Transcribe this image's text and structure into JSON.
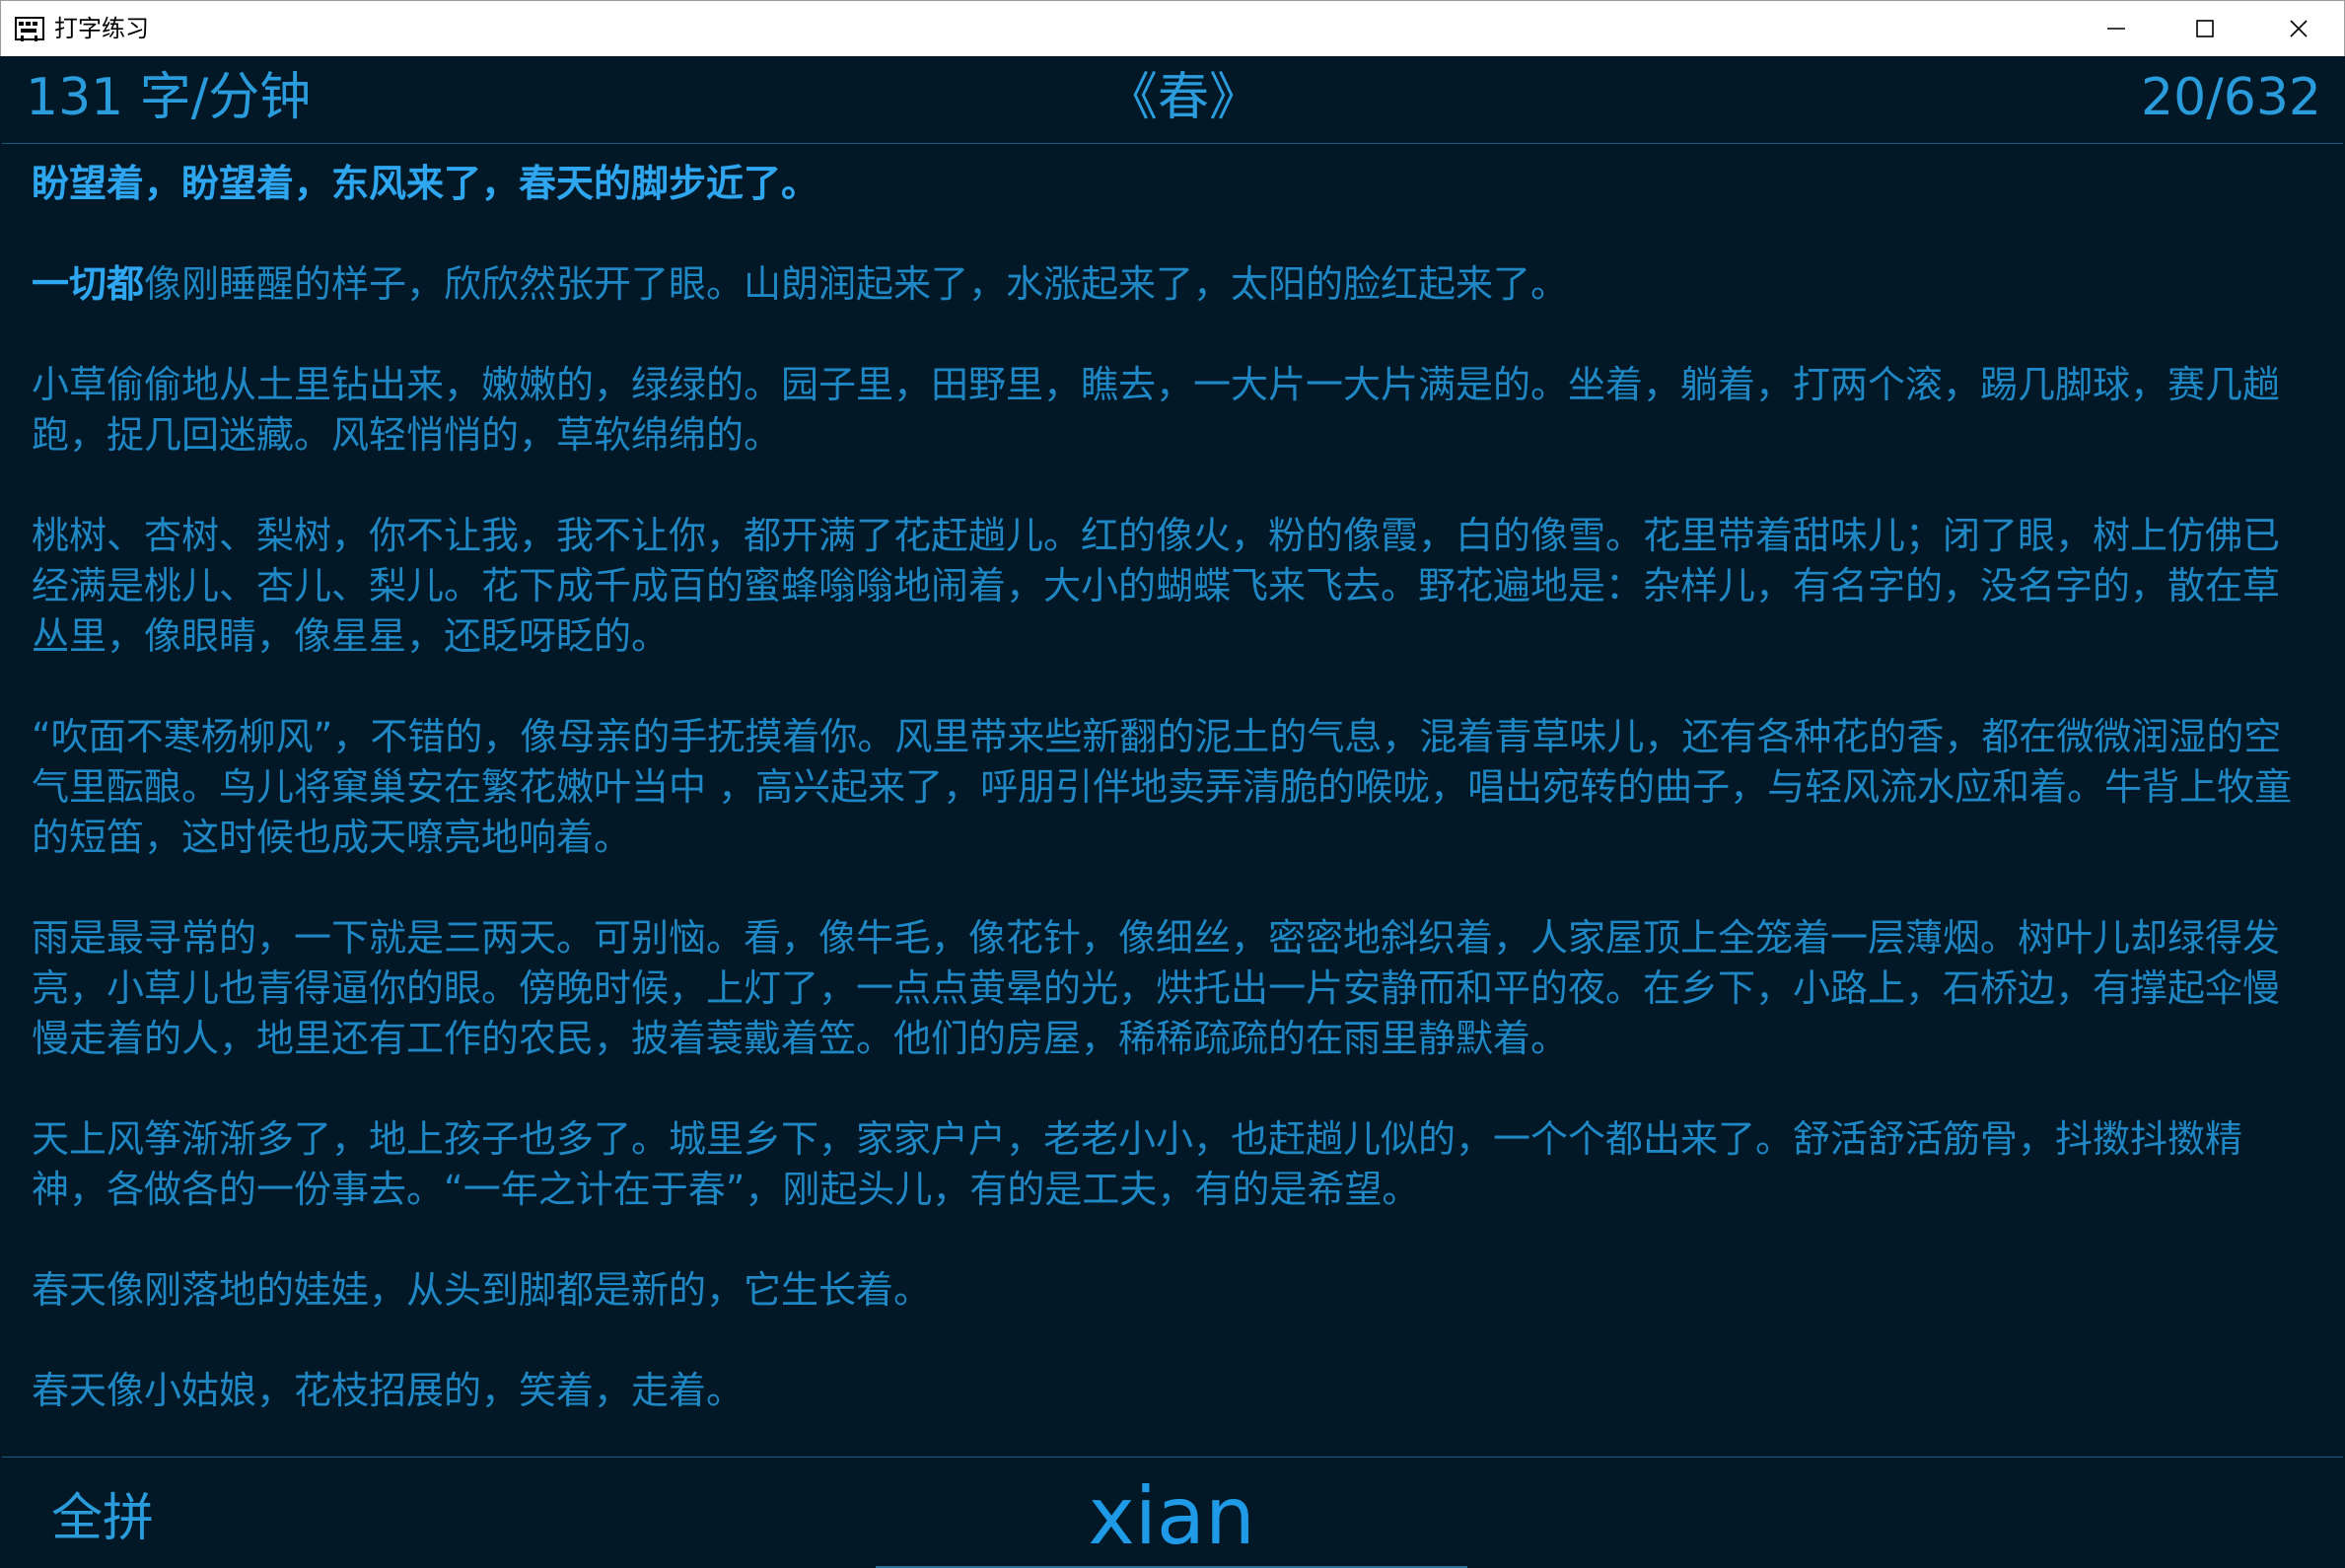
{
  "window": {
    "title": "打字练习"
  },
  "header": {
    "speed": "131 字/分钟",
    "article_title": "《春》",
    "progress": "20/632"
  },
  "content": {
    "paragraphs": [
      {
        "typed": "盼望着，盼望着，东风来了，春天的脚步近了。",
        "rest": ""
      },
      {
        "typed": "一切都",
        "rest": "像刚睡醒的样子，欣欣然张开了眼。山朗润起来了，水涨起来了，太阳的脸红起来了。"
      },
      {
        "typed": "",
        "rest": "小草偷偷地从土里钻出来，嫩嫩的，绿绿的。园子里，田野里，瞧去，一大片一大片满是的。坐着，躺着，打两个滚，踢几脚球，赛几趟跑，捉几回迷藏。风轻悄悄的，草软绵绵的。"
      },
      {
        "typed": "",
        "rest": "桃树、杏树、梨树，你不让我，我不让你，都开满了花赶趟儿。红的像火，粉的像霞，白的像雪。花里带着甜味儿；闭了眼，树上仿佛已经满是桃儿、杏儿、梨儿。花下成千成百的蜜蜂嗡嗡地闹着，大小的蝴蝶飞来飞去。野花遍地是：杂样儿，有名字的，没名字的，散在草丛里，像眼睛，像星星，还眨呀眨的。"
      },
      {
        "typed": "",
        "rest": "“吹面不寒杨柳风”，不错的，像母亲的手抚摸着你。风里带来些新翻的泥土的气息，混着青草味儿，还有各种花的香，都在微微润湿的空气里酝酿。鸟儿将窠巢安在繁花嫩叶当中 ，高兴起来了，呼朋引伴地卖弄清脆的喉咙，唱出宛转的曲子，与轻风流水应和着。牛背上牧童的短笛，这时候也成天嘹亮地响着。"
      },
      {
        "typed": "",
        "rest": "雨是最寻常的，一下就是三两天。可别恼。看，像牛毛，像花针，像细丝，密密地斜织着，人家屋顶上全笼着一层薄烟。树叶儿却绿得发亮，小草儿也青得逼你的眼。傍晚时候，上灯了，一点点黄晕的光，烘托出一片安静而和平的夜。在乡下，小路上，石桥边，有撑起伞慢慢走着的人，地里还有工作的农民，披着蓑戴着笠。他们的房屋，稀稀疏疏的在雨里静默着。"
      },
      {
        "typed": "",
        "rest": "天上风筝渐渐多了，地上孩子也多了。城里乡下，家家户户，老老小小，也赶趟儿似的，一个个都出来了。舒活舒活筋骨，抖擞抖擞精神，各做各的一份事去。“一年之计在于春”，刚起头儿，有的是工夫，有的是希望。"
      },
      {
        "typed": "",
        "rest": "春天像刚落地的娃娃，从头到脚都是新的，它生长着。"
      },
      {
        "typed": "",
        "rest": "春天像小姑娘，花枝招展的，笑着，走着。"
      }
    ]
  },
  "footer": {
    "mode": "全拼",
    "input_value": "xian"
  },
  "colors": {
    "background": "#021826",
    "text": "#1f88c4",
    "typed_text": "#2ea6f0",
    "accent": "#2a9bdb"
  },
  "icons": [
    "app-icon",
    "minimize-icon",
    "maximize-icon",
    "close-icon"
  ]
}
